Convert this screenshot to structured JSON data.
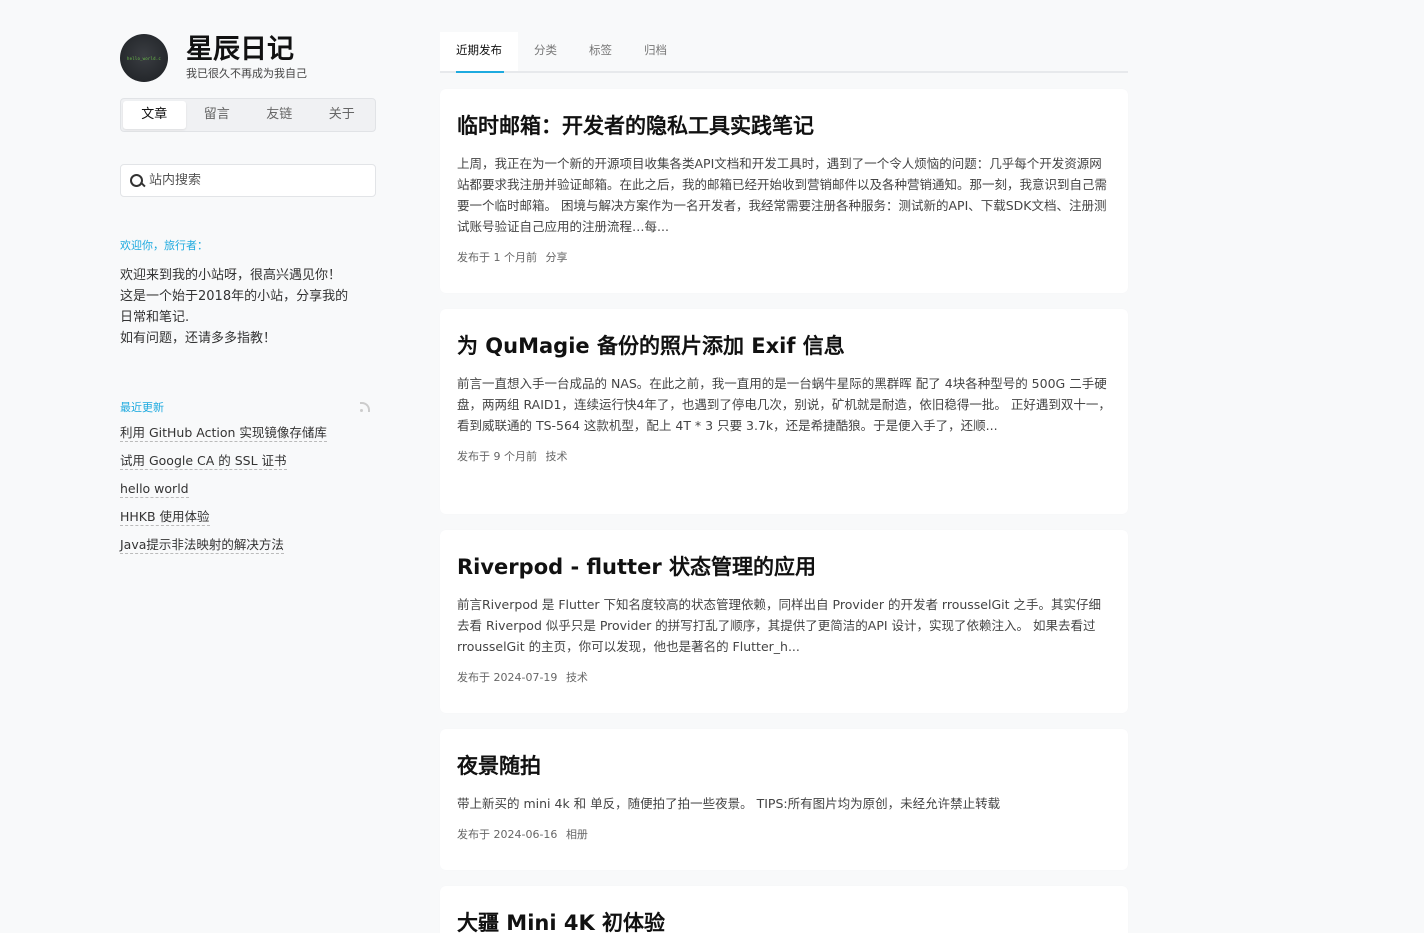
{
  "site": {
    "title": "星辰日记",
    "subtitle": "我已很久不再成为我自己",
    "avatar_text": "hello_world.c"
  },
  "nav": {
    "items": [
      {
        "label": "文章",
        "active": true
      },
      {
        "label": "留言",
        "active": false
      },
      {
        "label": "友链",
        "active": false
      },
      {
        "label": "关于",
        "active": false
      }
    ]
  },
  "search": {
    "placeholder": "站内搜索",
    "value": ""
  },
  "welcome": {
    "heading": "欢迎你，旅行者：",
    "lines": [
      "欢迎来到我的小站呀，很高兴遇见你！",
      "这是一个始于2018年的小站，分享我的",
      "日常和笔记.",
      "如有问题，还请多多指教！"
    ]
  },
  "recent": {
    "heading": "最近更新",
    "items": [
      "利用 GitHub Action 实现镜像存储库",
      "试用 Google CA 的 SSL 证书",
      "hello world",
      "HHKB 使用体验",
      "Java提示非法映射的解决方法"
    ]
  },
  "tabs": [
    {
      "label": "近期发布",
      "active": true
    },
    {
      "label": "分类",
      "active": false
    },
    {
      "label": "标签",
      "active": false
    },
    {
      "label": "归档",
      "active": false
    }
  ],
  "posts": [
    {
      "title": "临时邮箱：开发者的隐私工具实践笔记",
      "excerpt": "上周，我正在为一个新的开源项目收集各类API文档和开发工具时，遇到了一个令人烦恼的问题：几乎每个开发资源网站都要求我注册并验证邮箱。在此之后，我的邮箱已经开始收到营销邮件以及各种营销通知。那一刻，我意识到自己需要一个临时邮箱。 困境与解决方案作为一名开发者，我经常需要注册各种服务：测试新的API、下载SDK文档、注册测试账号验证自己应用的注册流程…每...",
      "meta_prefix": "发布于",
      "date": "1 个月前",
      "category": "分享"
    },
    {
      "title": "为 QuMagie 备份的照片添加 Exif 信息",
      "excerpt": "前言一直想入手一台成品的 NAS。在此之前，我一直用的是一台蜗牛星际的黑群晖 配了 4块各种型号的 500G 二手硬盘，两两组 RAID1，连续运行快4年了，也遇到了停电几次，别说，矿机就是耐造，依旧稳得一批。 正好遇到双十一，看到威联通的 TS-564 这款机型，配上 4T * 3 只要 3.7k，还是希捷酷狼。于是便入手了，还顺...",
      "meta_prefix": "发布于",
      "date": "9 个月前",
      "category": "技术"
    },
    {
      "title": "Riverpod - flutter 状态管理的应用",
      "excerpt": "前言Riverpod 是 Flutter 下知名度较高的状态管理依赖，同样出自 Provider 的开发者 rrousselGit 之手。其实仔细去看 Riverpod 似乎只是 Provider 的拼写打乱了顺序，其提供了更简洁的API 设计，实现了依赖注入。 如果去看过 rrousselGit 的主页，你可以发现，他也是著名的 Flutter_h...",
      "meta_prefix": "发布于",
      "date": "2024-07-19",
      "category": "技术"
    },
    {
      "title": "夜景随拍",
      "excerpt": "带上新买的 mini 4k 和 单反，随便拍了拍一些夜景。 TIPS:所有图片均为原创，未经允许禁止转载",
      "meta_prefix": "发布于",
      "date": "2024-06-16",
      "category": "相册"
    },
    {
      "title": "大疆 Mini 4K 初体验",
      "excerpt": "",
      "meta_prefix": "",
      "date": "",
      "category": ""
    }
  ]
}
